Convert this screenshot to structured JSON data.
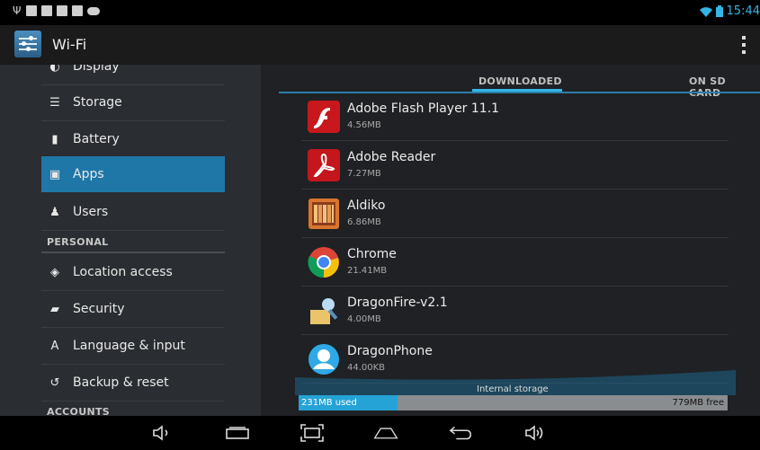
{
  "status_bar": {
    "time": "15:44",
    "wifi_icon": "wifi-icon",
    "battery_icon": "battery-icon"
  },
  "action_bar": {
    "title": "Wi-Fi",
    "icon": "settings-sliders-icon",
    "menu_icon": "overflow-menu-icon"
  },
  "sidebar": {
    "items": [
      {
        "label": "Display",
        "icon": "display-icon"
      },
      {
        "label": "Storage",
        "icon": "storage-icon"
      },
      {
        "label": "Battery",
        "icon": "battery-icon"
      },
      {
        "label": "Apps",
        "icon": "apps-icon",
        "selected": true
      },
      {
        "label": "Users",
        "icon": "users-icon"
      },
      {
        "label": "Location access",
        "icon": "location-icon"
      },
      {
        "label": "Security",
        "icon": "lock-icon"
      },
      {
        "label": "Language & input",
        "icon": "language-icon"
      },
      {
        "label": "Backup & reset",
        "icon": "backup-icon"
      }
    ],
    "sections": [
      "PERSONAL",
      "ACCOUNTS"
    ]
  },
  "tabs": [
    {
      "label": "DOWNLOADED",
      "selected": true
    },
    {
      "label": "ON SD CARD",
      "selected": false
    }
  ],
  "apps": [
    {
      "name": "Adobe Flash Player 11.1",
      "size": "4.56MB",
      "icon": "flash-player-icon"
    },
    {
      "name": "Adobe Reader",
      "size": "7.27MB",
      "icon": "adobe-reader-icon"
    },
    {
      "name": "Aldiko",
      "size": "6.86MB",
      "icon": "aldiko-icon"
    },
    {
      "name": "Chrome",
      "size": "21.41MB",
      "icon": "chrome-icon"
    },
    {
      "name": "DragonFire-v2.1",
      "size": "4.00MB",
      "icon": "dragonfire-icon"
    },
    {
      "name": "DragonPhone",
      "size": "44.00KB",
      "icon": "dragonphone-icon"
    }
  ],
  "storage": {
    "title": "Internal storage",
    "used": "231MB used",
    "free": "779MB free",
    "used_fraction": 0.23
  },
  "nav_bar": [
    "volume-down-icon",
    "recent-apps-icon",
    "screenshot-icon",
    "home-icon",
    "back-icon",
    "volume-up-icon"
  ],
  "colors": {
    "accent": "#33b5e5",
    "selected_item": "#1f77a8"
  }
}
